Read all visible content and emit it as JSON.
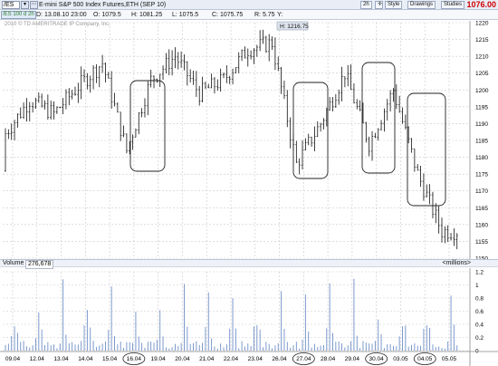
{
  "toolbar": {
    "symbol": "/ES",
    "instrument": "E-mini S&P 500 Index Futures,ETH (SEP 10)",
    "interval": "2h",
    "style_label": "Style",
    "drawings_label": "Drawings",
    "studies_label": "Studies",
    "last_price": "1076.00",
    "last_price_color": "#d00000"
  },
  "quotebar": {
    "aggregation": "/ES 100 d 2h",
    "date_field": "D: 13.08.10 23:00",
    "open_field": "O: 1079.5",
    "high_field": "H: 1081.25",
    "low_field": "L: 1075.5",
    "close_field": "C: 1075.75",
    "range_field": "R: 5.75",
    "y_field": "Y:"
  },
  "copyright": "2010 © TD AMERITRADE IP Company, Inc.",
  "price_panel": {
    "high_marker": "H: 1216.75",
    "y_ticks": [
      "1220",
      "1215",
      "1210",
      "1205",
      "1200",
      "1195",
      "1190",
      "1185",
      "1180",
      "1175",
      "1170",
      "1165",
      "1160",
      "1155",
      "1150"
    ]
  },
  "volume_panel": {
    "label": "Volume",
    "value": "276,678",
    "units": "<millions>",
    "y_ticks": [
      "1.2",
      "1",
      "0.8",
      "0.6",
      "0.4",
      "0.2",
      "0"
    ]
  },
  "x_axis": {
    "labels": [
      "09.04",
      "12.04",
      "13.04",
      "14.04",
      "15.04",
      "16.04",
      "19.04",
      "20.04",
      "21.04",
      "22.04",
      "23.04",
      "26.04",
      "27.04",
      "28.04",
      "29.04",
      "30.04",
      "03.05",
      "04.05",
      "05.05"
    ],
    "circled": [
      "16.04",
      "27.04",
      "30.04",
      "04.05"
    ]
  },
  "chart_data": {
    "type": "bar",
    "ohlc_anchors": {
      "note_units": "price in index points",
      "x": [
        "09.04",
        "12.04",
        "13.04",
        "14.04",
        "15.04",
        "16.04",
        "19.04",
        "20.04",
        "21.04",
        "22.04",
        "23.04",
        "26.04",
        "27.04",
        "28.04",
        "29.04",
        "30.04",
        "03.05",
        "04.05",
        "05.05"
      ],
      "close": [
        1187,
        1197,
        1193,
        1201,
        1208,
        1182,
        1203,
        1210,
        1199,
        1203,
        1212,
        1214,
        1178,
        1190,
        1205,
        1184,
        1200,
        1175,
        1158
      ]
    },
    "price_ylim": [
      1150,
      1220
    ],
    "volume_ylim_millions": [
      0,
      1.2
    ],
    "grid": true
  }
}
